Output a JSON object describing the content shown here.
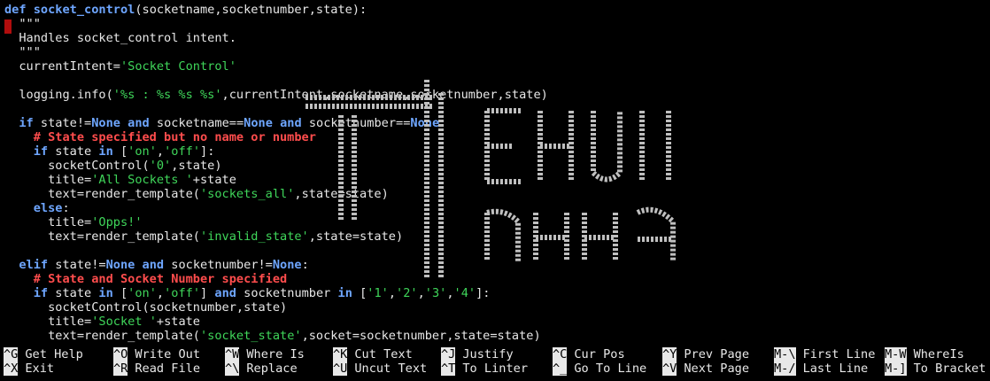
{
  "editor": {
    "lines": [
      {
        "segments": [
          {
            "t": "def ",
            "c": "kw"
          },
          {
            "t": "socket_control",
            "c": "fn"
          },
          {
            "t": "(socketname,socketnumber,state):",
            "c": ""
          }
        ]
      },
      {
        "segments": [
          {
            "t": "  \"\"\"",
            "c": ""
          }
        ]
      },
      {
        "segments": [
          {
            "t": "  Handles socket_control intent.",
            "c": ""
          }
        ]
      },
      {
        "segments": [
          {
            "t": "  \"\"\"",
            "c": ""
          }
        ]
      },
      {
        "segments": [
          {
            "t": "  currentIntent=",
            "c": ""
          },
          {
            "t": "'Socket Control'",
            "c": "str"
          }
        ]
      },
      {
        "segments": [
          {
            "t": "",
            "c": ""
          }
        ]
      },
      {
        "segments": [
          {
            "t": "  logging.info(",
            "c": ""
          },
          {
            "t": "'%s : %s %s %s'",
            "c": "str"
          },
          {
            "t": ",currentIntent,socketname,socketnumber,state)",
            "c": ""
          }
        ]
      },
      {
        "segments": [
          {
            "t": "",
            "c": ""
          }
        ]
      },
      {
        "segments": [
          {
            "t": "  ",
            "c": ""
          },
          {
            "t": "if",
            "c": "kw"
          },
          {
            "t": " state!=",
            "c": ""
          },
          {
            "t": "None",
            "c": "kw"
          },
          {
            "t": " ",
            "c": ""
          },
          {
            "t": "and",
            "c": "kw"
          },
          {
            "t": " socketname==",
            "c": ""
          },
          {
            "t": "None",
            "c": "kw"
          },
          {
            "t": " ",
            "c": ""
          },
          {
            "t": "and",
            "c": "kw"
          },
          {
            "t": " socketnumber==",
            "c": ""
          },
          {
            "t": "None",
            "c": "kw"
          },
          {
            "t": ":",
            "c": ""
          }
        ]
      },
      {
        "segments": [
          {
            "t": "    # State specified but no name or number",
            "c": "cm"
          }
        ]
      },
      {
        "segments": [
          {
            "t": "    ",
            "c": ""
          },
          {
            "t": "if",
            "c": "kw"
          },
          {
            "t": " state ",
            "c": ""
          },
          {
            "t": "in",
            "c": "kw"
          },
          {
            "t": " [",
            "c": ""
          },
          {
            "t": "'on'",
            "c": "str"
          },
          {
            "t": ",",
            "c": ""
          },
          {
            "t": "'off'",
            "c": "str"
          },
          {
            "t": "]:",
            "c": ""
          }
        ]
      },
      {
        "segments": [
          {
            "t": "      socketControl(",
            "c": ""
          },
          {
            "t": "'0'",
            "c": "str"
          },
          {
            "t": ",state)",
            "c": ""
          }
        ]
      },
      {
        "segments": [
          {
            "t": "      title=",
            "c": ""
          },
          {
            "t": "'All Sockets '",
            "c": "str"
          },
          {
            "t": "+state",
            "c": ""
          }
        ]
      },
      {
        "segments": [
          {
            "t": "      text=render_template(",
            "c": ""
          },
          {
            "t": "'sockets_all'",
            "c": "str"
          },
          {
            "t": ",state=state)",
            "c": ""
          }
        ]
      },
      {
        "segments": [
          {
            "t": "    ",
            "c": ""
          },
          {
            "t": "else",
            "c": "kw"
          },
          {
            "t": ":",
            "c": ""
          }
        ]
      },
      {
        "segments": [
          {
            "t": "      title=",
            "c": ""
          },
          {
            "t": "'Opps!'",
            "c": "str"
          }
        ]
      },
      {
        "segments": [
          {
            "t": "      text=render_template(",
            "c": ""
          },
          {
            "t": "'invalid_state'",
            "c": "str"
          },
          {
            "t": ",state=state)",
            "c": ""
          }
        ]
      },
      {
        "segments": [
          {
            "t": "",
            "c": ""
          }
        ]
      },
      {
        "segments": [
          {
            "t": "  ",
            "c": ""
          },
          {
            "t": "elif",
            "c": "kw"
          },
          {
            "t": " state!=",
            "c": ""
          },
          {
            "t": "None",
            "c": "kw"
          },
          {
            "t": " ",
            "c": ""
          },
          {
            "t": "and",
            "c": "kw"
          },
          {
            "t": " socketnumber!=",
            "c": ""
          },
          {
            "t": "None",
            "c": "kw"
          },
          {
            "t": ":",
            "c": ""
          }
        ]
      },
      {
        "segments": [
          {
            "t": "    # State and Socket Number specified",
            "c": "cm"
          }
        ]
      },
      {
        "segments": [
          {
            "t": "    ",
            "c": ""
          },
          {
            "t": "if",
            "c": "kw"
          },
          {
            "t": " state ",
            "c": ""
          },
          {
            "t": "in",
            "c": "kw"
          },
          {
            "t": " [",
            "c": ""
          },
          {
            "t": "'on'",
            "c": "str"
          },
          {
            "t": ",",
            "c": ""
          },
          {
            "t": "'off'",
            "c": "str"
          },
          {
            "t": "] ",
            "c": ""
          },
          {
            "t": "and",
            "c": "kw"
          },
          {
            "t": " socketnumber ",
            "c": ""
          },
          {
            "t": "in",
            "c": "kw"
          },
          {
            "t": " [",
            "c": ""
          },
          {
            "t": "'1'",
            "c": "str"
          },
          {
            "t": ",",
            "c": ""
          },
          {
            "t": "'2'",
            "c": "str"
          },
          {
            "t": ",",
            "c": ""
          },
          {
            "t": "'3'",
            "c": "str"
          },
          {
            "t": ",",
            "c": ""
          },
          {
            "t": "'4'",
            "c": "str"
          },
          {
            "t": "]:",
            "c": ""
          }
        ]
      },
      {
        "segments": [
          {
            "t": "      socketControl(socketnumber,state)",
            "c": ""
          }
        ]
      },
      {
        "segments": [
          {
            "t": "      title=",
            "c": ""
          },
          {
            "t": "'Socket '",
            "c": "str"
          },
          {
            "t": "+state",
            "c": ""
          }
        ]
      },
      {
        "segments": [
          {
            "t": "      text=render_template(",
            "c": ""
          },
          {
            "t": "'socket_state'",
            "c": "str"
          },
          {
            "t": ",socket=socketnumber,state=state)",
            "c": ""
          }
        ]
      }
    ]
  },
  "shortcuts": [
    {
      "key": "^G",
      "label": "Get Help"
    },
    {
      "key": "^X",
      "label": "Exit"
    },
    {
      "key": "^O",
      "label": "Write Out"
    },
    {
      "key": "^R",
      "label": "Read File"
    },
    {
      "key": "^W",
      "label": "Where Is"
    },
    {
      "key": "^\\",
      "label": "Replace"
    },
    {
      "key": "^K",
      "label": "Cut Text"
    },
    {
      "key": "^U",
      "label": "Uncut Text"
    },
    {
      "key": "^J",
      "label": "Justify"
    },
    {
      "key": "^T",
      "label": "To Linter"
    },
    {
      "key": "^C",
      "label": "Cur Pos"
    },
    {
      "key": "^_",
      "label": "Go To Line"
    },
    {
      "key": "^Y",
      "label": "Prev Page"
    },
    {
      "key": "^V",
      "label": "Next Page"
    },
    {
      "key": "M-\\",
      "label": "First Line"
    },
    {
      "key": "M-/",
      "label": "Last Line"
    },
    {
      "key": "M-W",
      "label": "WhereIs"
    },
    {
      "key": "M-]",
      "label": "To Bracket"
    }
  ],
  "colors": {
    "background": "#000000",
    "text": "#e8e8e8",
    "keyword": "#6ea6ff",
    "string": "#3fd65a",
    "comment": "#ff4d4d",
    "cursor": "#b10d0d"
  },
  "overlay": {
    "icon": "ascii-art-logo-icon"
  }
}
